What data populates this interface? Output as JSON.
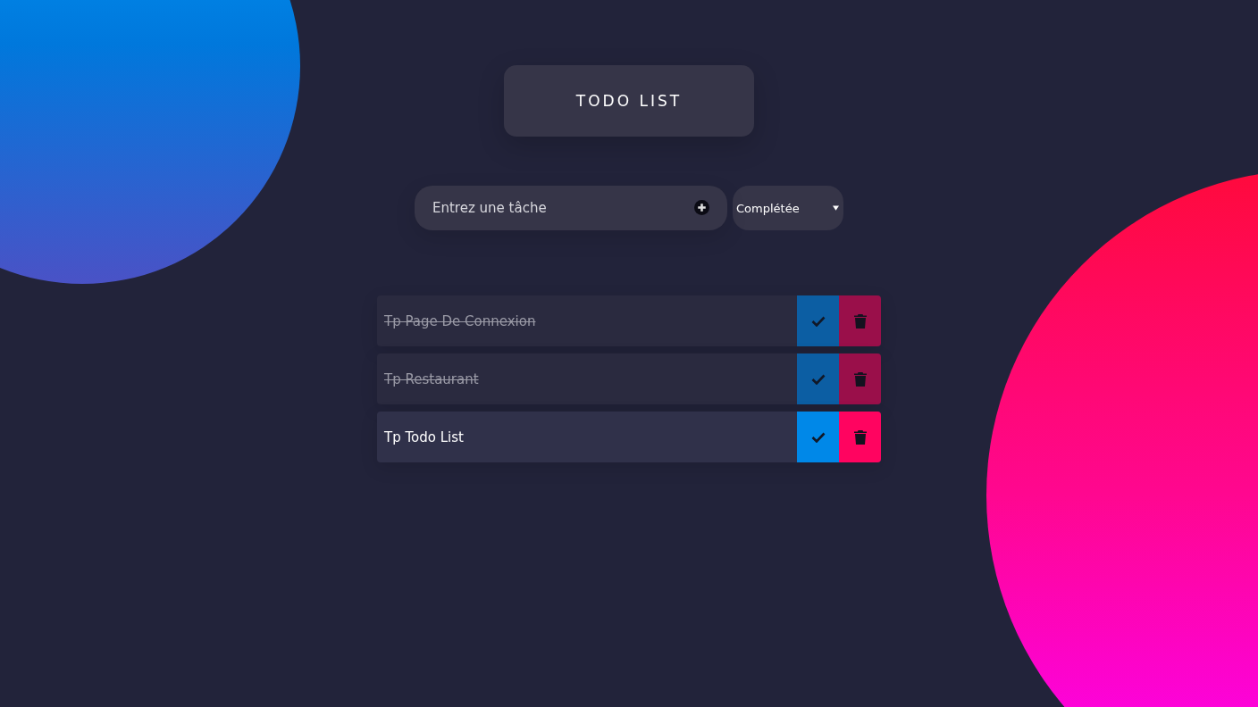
{
  "header": {
    "title": "TODO LIST"
  },
  "task_input": {
    "placeholder": "Entrez une tâche"
  },
  "filter": {
    "value": "Complétée"
  },
  "todos": [
    {
      "text": "Tp Page De Connexion",
      "completed": true
    },
    {
      "text": "Tp Restaurant",
      "completed": true
    },
    {
      "text": "Tp Todo List",
      "completed": false
    }
  ]
}
